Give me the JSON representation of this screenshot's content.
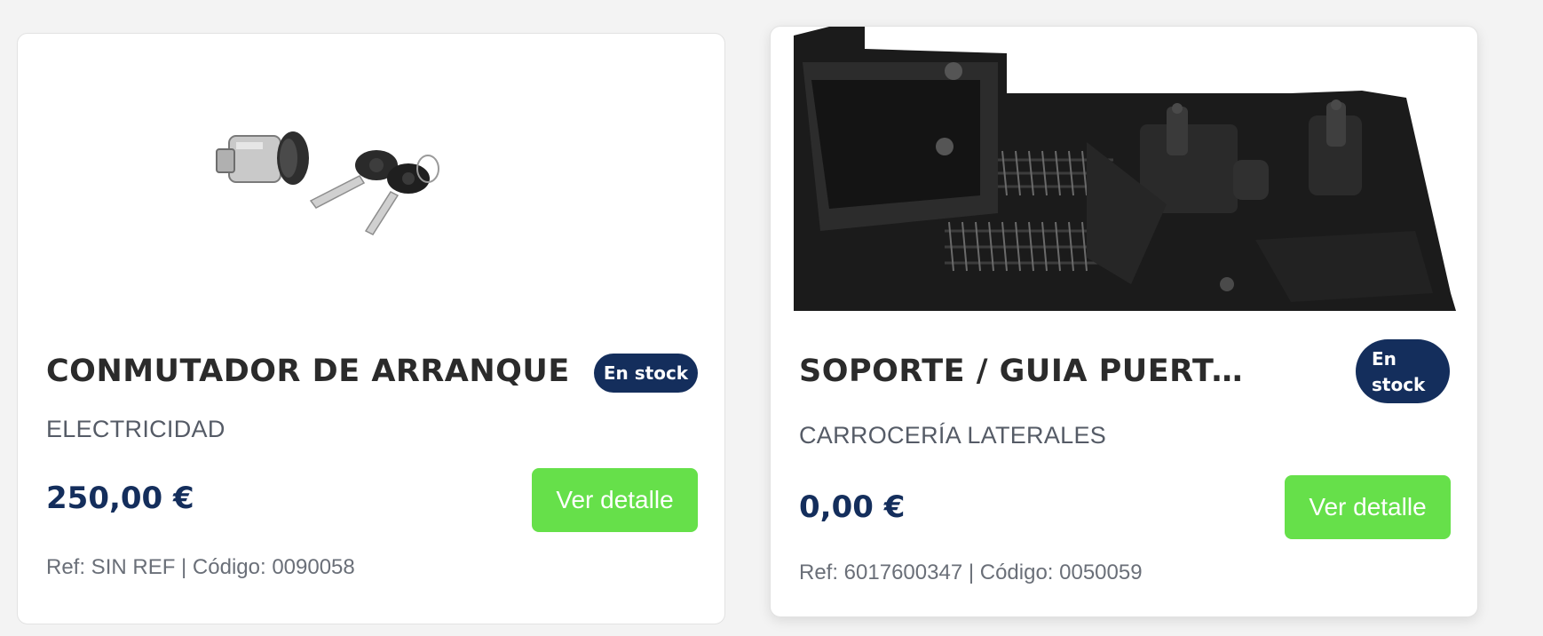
{
  "products": [
    {
      "title": "CONMUTADOR DE ARRANQUE",
      "stock_badge": "En stock",
      "category": "ELECTRICIDAD",
      "price": "250,00 €",
      "button_label": "Ver detalle",
      "ref_code": "Ref: SIN REF | Código: 0090058",
      "image": "ignition-switch-with-keys"
    },
    {
      "title": "SOPORTE / GUIA PUERTA...",
      "stock_badge": "En stock",
      "category": "CARROCERÍA LATERALES",
      "price": "0,00 €",
      "button_label": "Ver detalle",
      "ref_code": "Ref: 6017600347 | Código: 0050059",
      "image": "black-door-guide-bracket"
    }
  ],
  "colors": {
    "badge_bg": "#142e5c",
    "button_bg": "#66e04a",
    "price": "#142e5c"
  }
}
